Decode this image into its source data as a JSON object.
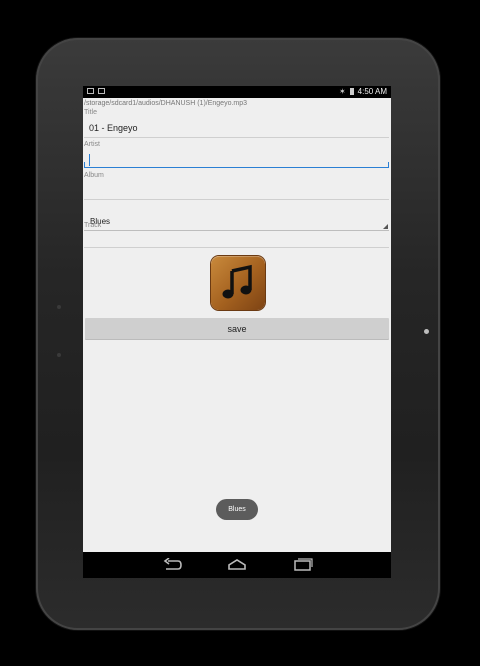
{
  "status_bar": {
    "time": "4:50 AM",
    "left_icons": [
      "image-icon",
      "gallery-icon"
    ],
    "right_icons": [
      "bluetooth-icon",
      "battery-icon"
    ]
  },
  "editor": {
    "file_path": "/storage/sdcard1/audios/DHANUSH (1)/Engeyo.mp3",
    "title_label": "Title",
    "title_value": "01 - Engeyo",
    "artist_label": "Artist",
    "artist_value": "",
    "album_label": "Album",
    "album_value": "",
    "genre_value": "Blues",
    "track_label": "Track",
    "track_value": "",
    "save_label": "save"
  },
  "toast": {
    "text": "Blues"
  },
  "nav_bar": {
    "icons": [
      "back-icon",
      "home-icon",
      "recents-icon"
    ]
  },
  "colors": {
    "accent": "#2a7fd4",
    "app_background": "#efefef",
    "button_background": "#cfcfcf",
    "toast_background": "#5c5c5c"
  }
}
